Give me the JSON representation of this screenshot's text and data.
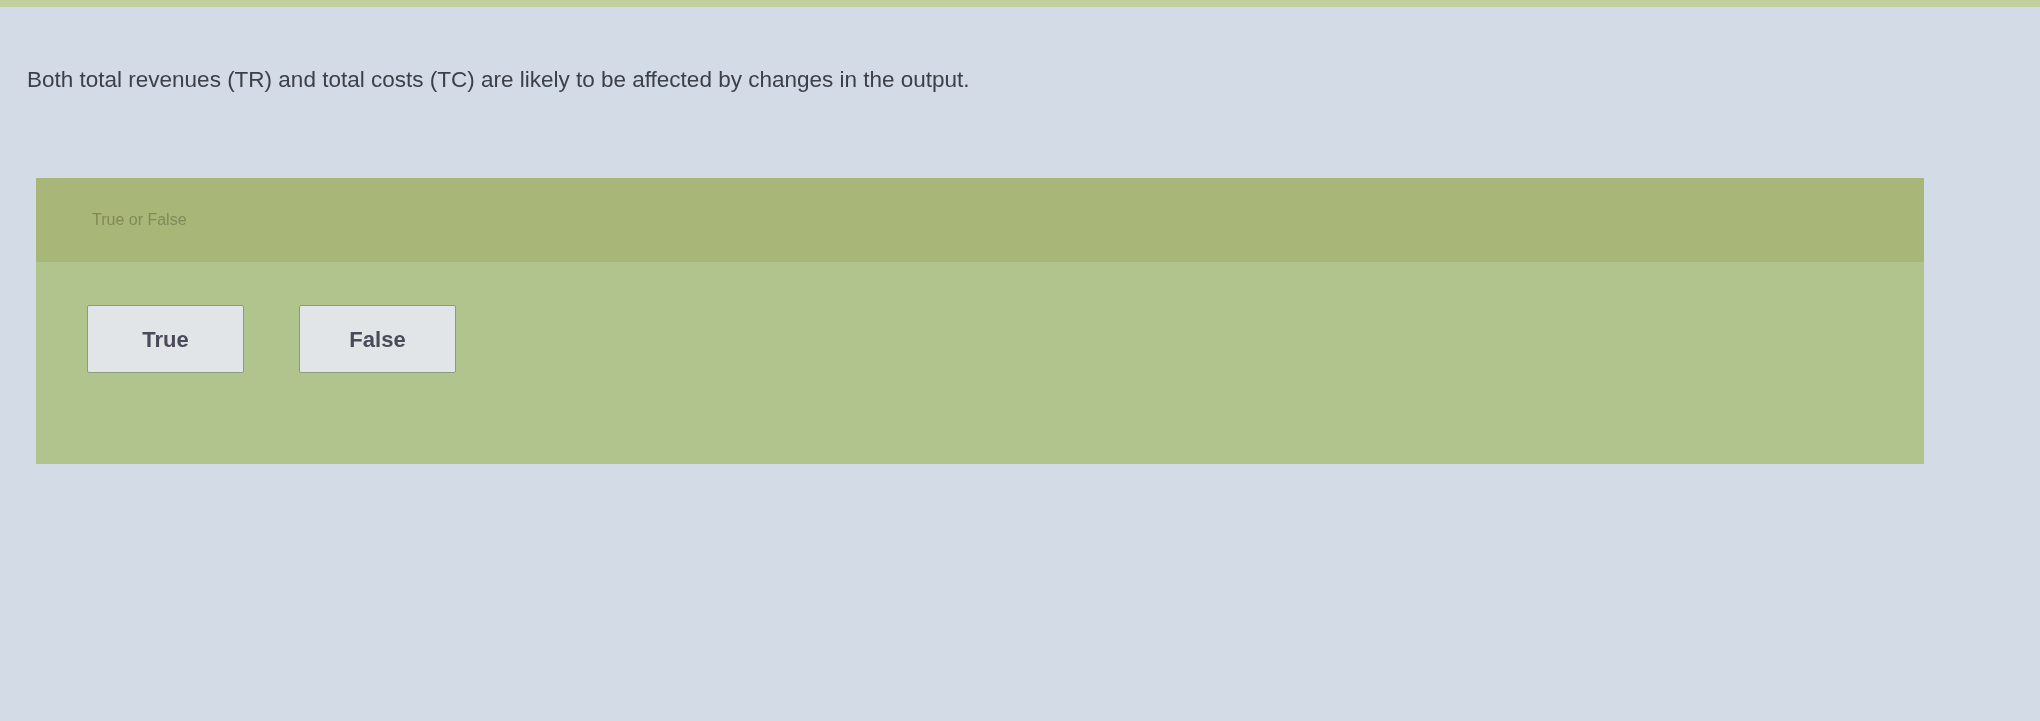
{
  "question": "Both total revenues (TR) and total costs (TC) are likely to be affected by changes in the output.",
  "answer_panel": {
    "title": "True or False",
    "options": [
      {
        "label": "True",
        "selected": false
      },
      {
        "label": "False",
        "selected": false
      }
    ]
  }
}
